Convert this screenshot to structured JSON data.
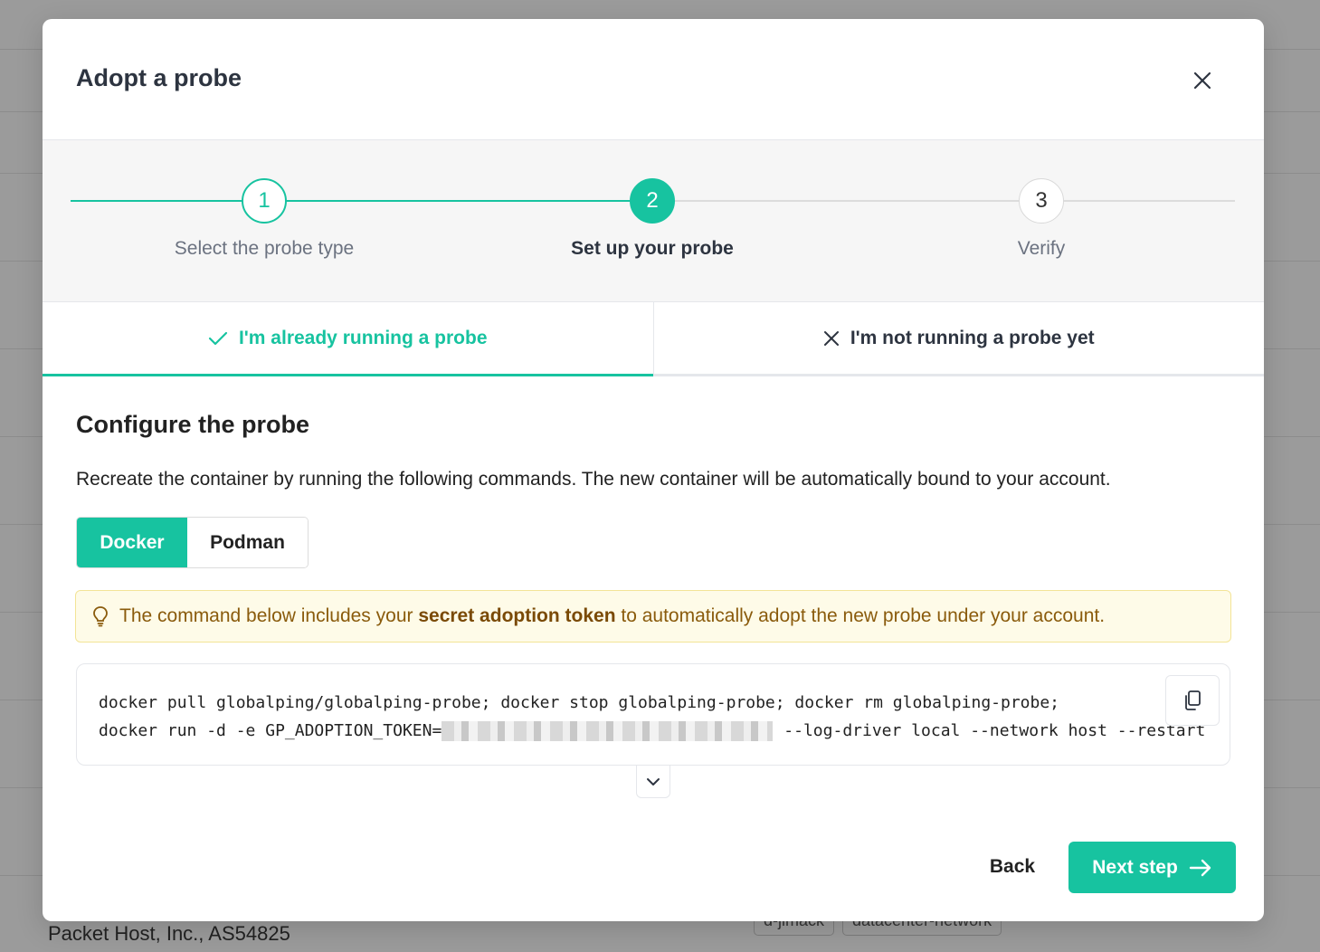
{
  "background": {
    "footer_text": "Packet Host, Inc., AS54825",
    "tags": [
      "d-jimack",
      "datacenter-network"
    ]
  },
  "modal": {
    "title": "Adopt a probe",
    "stepper": {
      "steps": [
        {
          "number": "1",
          "label": "Select the probe type",
          "state": "done"
        },
        {
          "number": "2",
          "label": "Set up your probe",
          "state": "current"
        },
        {
          "number": "3",
          "label": "Verify",
          "state": "todo"
        }
      ]
    },
    "tabs": [
      {
        "label": "I'm already running a probe",
        "icon": "check-icon",
        "active": true
      },
      {
        "label": "I'm not running a probe yet",
        "icon": "x-icon",
        "active": false
      }
    ],
    "section_title": "Configure the probe",
    "description": "Recreate the container by running the following commands. The new container will be automatically bound to your account.",
    "runtime": {
      "options": [
        "Docker",
        "Podman"
      ],
      "selected": "Docker"
    },
    "notice": {
      "icon": "lightbulb-icon",
      "text_before": "The command below includes your ",
      "text_bold": "secret adoption token",
      "text_after": " to automatically adopt the new probe under your account."
    },
    "command": {
      "line1": "docker pull globalping/globalping-probe; docker stop globalping-probe; docker rm globalping-probe;",
      "line2_prefix": "docker run -d -e GP_ADOPTION_TOKEN=",
      "line2_suffix": "--log-driver local --network host --restart"
    },
    "footer": {
      "back_label": "Back",
      "next_label": "Next step"
    }
  },
  "colors": {
    "accent": "#17c3a0",
    "notice_bg": "#fefbe8",
    "notice_text": "#8a5b0c"
  }
}
